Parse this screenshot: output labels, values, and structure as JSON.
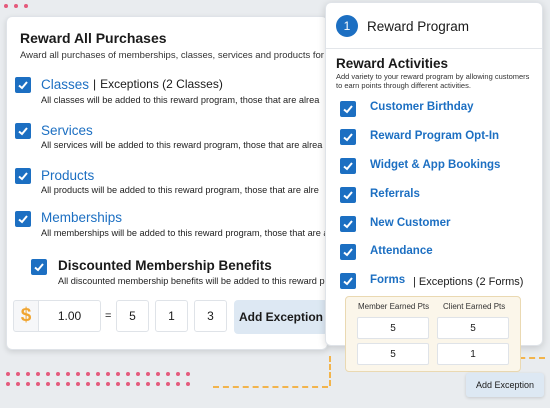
{
  "left_card": {
    "title": "Reward All Purchases",
    "subtitle": "Award all purchases of memberships, classes, services and products for a",
    "rows": [
      {
        "label": "Classes",
        "exceptions": "Exceptions (2 Classes)",
        "desc": "All classes will be added to this reward program, those that are alrea"
      },
      {
        "label": "Services",
        "desc": "All services will be added to this reward program, those that are alrea"
      },
      {
        "label": "Products",
        "desc": "All products will be added to this reward program, those that are alre"
      },
      {
        "label": "Memberships",
        "desc": "All memberships will be added to this reward program, those that are a"
      }
    ],
    "sub_row": {
      "label": "Discounted Membership Benefits",
      "desc": "All discounted membership benefits will be added to this reward progra"
    },
    "conversion": {
      "currency_symbol": "$",
      "amount": "1.00",
      "equals": "=",
      "values": [
        "5",
        "1",
        "3"
      ]
    },
    "add_exception_label": "Add Exception"
  },
  "right_card": {
    "step_number": "1",
    "step_title": "Reward Program",
    "activities_title": "Reward Activities",
    "activities_desc": "Add variety to your reward program by allowing customers to earn points through different activities.",
    "activities": [
      {
        "label": "Customer Birthday"
      },
      {
        "label": "Reward Program Opt-In"
      },
      {
        "label": "Widget & App Bookings"
      },
      {
        "label": "Referrals"
      },
      {
        "label": "New Customer"
      },
      {
        "label": "Attendance"
      },
      {
        "label": "Forms",
        "exceptions": "Exceptions (2 Forms)"
      }
    ],
    "points_table": {
      "headers": [
        "Member Earned Pts",
        "Client Earned Pts"
      ],
      "rows": [
        [
          "5",
          "5"
        ],
        [
          "5",
          "1"
        ]
      ]
    },
    "add_exception_label": "Add Exception"
  },
  "colors": {
    "accent": "#1c6fc2",
    "dollar": "#f0a531",
    "dots": "#e55a7c",
    "dashes": "#f2b44c"
  }
}
